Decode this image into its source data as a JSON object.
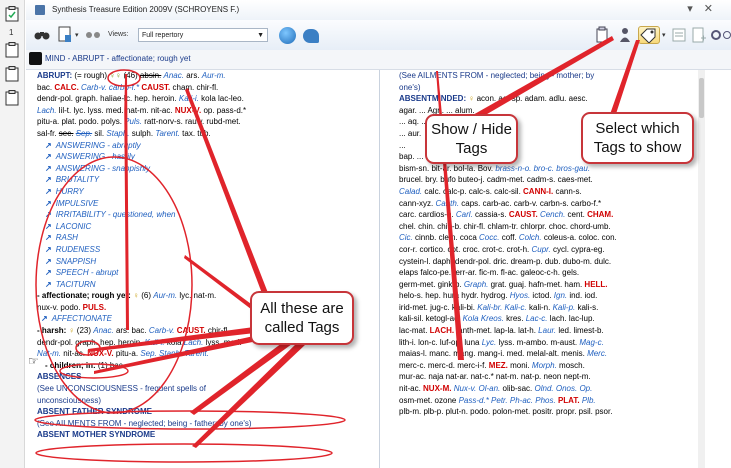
{
  "window": {
    "title": "Synthesis Treasure Edition 2009V (SCHROYENS F.)",
    "controls": "▾ ✕"
  },
  "left_sidebar": {
    "count": "1"
  },
  "toolbar": {
    "views_label": "Views:",
    "views_value": "Full repertory"
  },
  "breadcrumb": {
    "text": "MIND - ABRUPT - affectionate; rough yet"
  },
  "col1": {
    "abrupt_head": "ABRUPT:",
    "abrupt_rough": " (= rough)",
    "abrupt_count": " (46) ",
    "abrupt_l1_parts": [
      "absin.",
      " ",
      "Anac.",
      " ars. ",
      "Aur-m."
    ],
    "abrupt_l2_parts": [
      "bac. ",
      "CALC.",
      " ",
      "Carb-v.",
      " ",
      "carbo-f.*",
      " ",
      "CAUST.",
      " cham. chir-fl."
    ],
    "abrupt_l3": "dendr-pol. graph. haliae-lc. hep. heroin. ",
    "abrupt_l3_b": "Kali-i.",
    "abrupt_l3_c": " kola lac-leo.",
    "abrupt_l4_a": "Lach.",
    "abrupt_l4_b": " lil-t. lyc. lyss. med. nat-m. nit-ac. ",
    "abrupt_l4_c": "NUX-V.",
    "abrupt_l4_d": " op. pass-d.*",
    "abrupt_l5_a": "pitu-a. plat. podo. polys. ",
    "abrupt_l5_b": "Puls.",
    "abrupt_l5_c": " ratt-norv-s. rauw. rubd-met.",
    "abrupt_l6_a": "sal-fr. ",
    "abrupt_l6_b": "sec.",
    "abrupt_l6_c": " ",
    "abrupt_l6_d": "Sep.",
    "abrupt_l6_e": " sil. ",
    "abrupt_l6_f": "Staph.",
    "abrupt_l6_g": " sulph. ",
    "abrupt_l6_h": "Tarent.",
    "abrupt_l6_i": " tax. tub.",
    "tags": [
      "ANSWERING - abruptly",
      "ANSWERING - hastily",
      "ANSWERING - snappishly",
      "BRUTALITY",
      "HURRY",
      "IMPULSIVE",
      "IRRITABILITY - questioned, when",
      "LACONIC",
      "RASH",
      "RUDENESS",
      "SNAPPISH",
      "SPEECH - abrupt",
      "TACITURN"
    ],
    "aff_head": "- affectionate; rough yet:",
    "aff_count": " (6) ",
    "aff_l1_a": "Aur-m.",
    "aff_l1_b": " lyc. nat-m.",
    "aff_l2_a": "nux-v. podo. ",
    "aff_l2_b": "PULS.",
    "aff_tag": "AFFECTIONATE",
    "harsh_head": "- harsh:",
    "harsh_count": " (23) ",
    "harsh_l1_a": "Anac.",
    "harsh_l1_b": " ars. bac. ",
    "harsh_l1_c": "Carb-v.",
    "harsh_l1_d": " ",
    "harsh_l1_e": "CAUST.",
    "harsh_l1_f": " chir-fl.",
    "harsh_l2_a": "dendr-pol. graph. hep. heroin. ",
    "harsh_l2_b": "Kali-i.",
    "harsh_l2_c": " kola ",
    "harsh_l2_d": "Lach.",
    "harsh_l2_e": " lyss. med.",
    "harsh_l3_a": "Nat-m.",
    "harsh_l3_b": " nit-ac. ",
    "harsh_l3_c": "NUX-V.",
    "harsh_l3_d": " pitu-a. ",
    "harsh_l3_e": "Sep.",
    "harsh_l3_f": " ",
    "harsh_l3_g": "Staph.",
    "harsh_l3_h": " ",
    "harsh_l3_i": "Tarent.",
    "children": "- children; in:",
    "children_val": " (1) bac.",
    "absences": "ABSENCES",
    "absences_ref": "(See UNCONSCIOUSNESS - frequent spells of",
    "absences_ref2": "unconsciousness)",
    "absent_father": "ABSENT FATHER SYNDROME",
    "absent_father_ref": "(See AILMENTS FROM - neglected; being - father; by one's)",
    "absent_mother": "ABSENT MOTHER SYNDROME"
  },
  "col2": {
    "ref1": "(See AILMENTS FROM - neglected; being - mother; by",
    "ref1b": "one's)",
    "absentminded": "ABSENTMINDED:",
    "am_l1": "acon. act-sp. adam. adlu. aesc.",
    "am_l2": "agar. ... Agn. ... alum.",
    "am_l3": "... aq. ...",
    "am_l4": "... aur.",
    "am_l5": "...",
    "am_l6": "bap. ... bar-m.",
    "lines": [
      [
        "bism-sn. bit-ar. bol-la. ",
        "",
        "Bov.",
        " brass-n-o. bro-c. bros-gau."
      ],
      [
        "brucel. bry. bufo buteo-j. cadm-met. cadm-s. caes-met.",
        "",
        "",
        ""
      ],
      [
        "",
        "Calad.",
        " calc. calc-p. calc-s. calc-sil. ",
        "CANN-I.",
        " cann-s."
      ],
      [
        "cann-xyz. ",
        "Canth.",
        " caps. carb-ac. carb-v. carbn-s. carbo-f.*"
      ],
      [
        "carc. cardios-h. ",
        "Carl.",
        " cassia-s. ",
        "CAUST.",
        " ",
        "Cench.",
        " cent. ",
        "CHAM."
      ],
      [
        "chel. chin. chin-b. chir-fl. chlam-tr. chlorpr. choc. chord-umb."
      ],
      [
        "",
        "Cic.",
        " cinnb. clem. coca ",
        "Cocc.",
        " coff. ",
        "Colch.",
        " coleus-a. coloc. con."
      ],
      [
        "cor-r. cortico. cot. croc. crot-c. crot-h. ",
        "Cupr.",
        " cycl. cypra-eg."
      ],
      [
        "cystein-l. daph. dendr-pol. dric. dream-p. dub. dubo-m. dulc."
      ],
      [
        "elaps falco-pe. ferr-ar. fic-m. fl-ac. galeoc-c-h. gels."
      ],
      [
        "germ-met. gink-b. ",
        "Graph.",
        " grat. guaj. hafn-met. ham. ",
        "HELL."
      ],
      [
        "helo-s. hep. hura hydr. hydrog. ",
        "Hyos.",
        " ictod. ",
        "Ign.",
        " ind. iod."
      ],
      [
        "irid-met. jug-c. kali-bi. ",
        "Kali-br.",
        " ",
        "Kali-c.",
        " kali-n. ",
        "Kali-p.",
        " kali-s."
      ],
      [
        "kali-sil. ketogl-ac. ",
        "Kola Kreos.",
        " kres. ",
        "Lac-c.",
        " lach. lac-lup."
      ],
      [
        "lac-mat. ",
        "LACH.",
        " lanth-met. lap-la. lat-h. ",
        "Laur.",
        " led. limest-b."
      ],
      [
        "lith-i. lon-c. luf-op. luna ",
        "Lyc.",
        " lyss. m-ambo. m-aust. ",
        "Mag-c."
      ],
      [
        "maias-l. manc. mang. mang-i. med. melal-alt. menis. ",
        "Merc."
      ],
      [
        "merc-c. merc-d. merc-i-f. ",
        "MEZ.",
        " moni. ",
        "Morph.",
        " mosch."
      ],
      [
        "mur-ac. naja nat-ar. nat-c.* nat-m. nat-p. neon nept-m."
      ],
      [
        "nit-ac. ",
        "NUX-M.",
        " ",
        "Nux-v.",
        " ",
        "Ol-an.",
        " olib-sac. ",
        "Olnd.",
        " ",
        "Onos.",
        " ",
        "Op."
      ],
      [
        "osm-met. ozone ",
        "Pass-d.*",
        " ",
        "Petr.",
        " ",
        "Ph-ac.",
        " ",
        "Phos.",
        " ",
        "PLAT.",
        " ",
        "Plb."
      ],
      [
        "plb-m. plb-p. plut-n. podo. polon-met. positr. propr. psil. psor."
      ]
    ]
  },
  "callouts": {
    "show_hide": "Show / Hide Tags",
    "select": "Select which Tags to show",
    "all_tags": "All these are called Tags"
  },
  "colors": {
    "callout_border": "#c7353a",
    "annotation_red": "#e0242b"
  }
}
